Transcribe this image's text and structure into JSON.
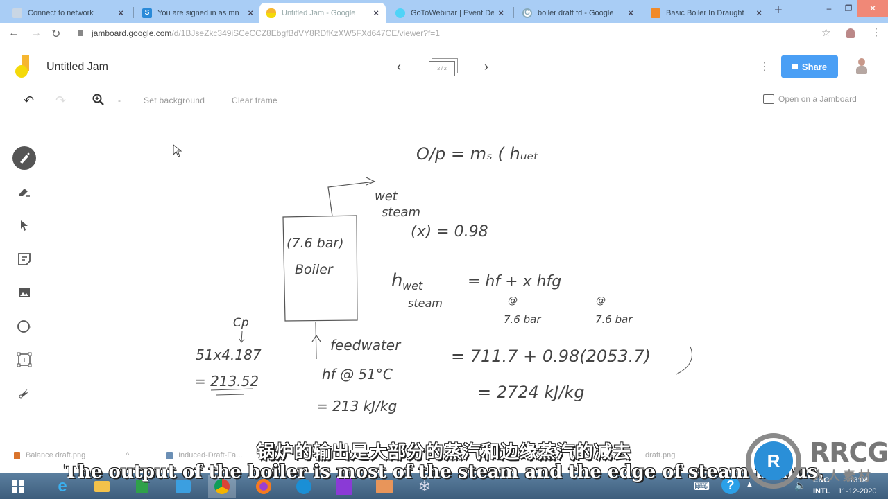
{
  "browser": {
    "tabs": [
      {
        "label": "Connect to network",
        "icon": "network-icon",
        "active": false
      },
      {
        "label": "You are signed in as mn",
        "icon": "s-app-icon",
        "active": false
      },
      {
        "label": "Untitled Jam - Google",
        "icon": "jamboard-icon",
        "active": true
      },
      {
        "label": "GoToWebinar | Event De",
        "icon": "gotowebinar-icon",
        "active": false
      },
      {
        "label": "boiler draft fd - Google",
        "icon": "google-icon",
        "active": false
      },
      {
        "label": "Basic Boiler In Draught",
        "icon": "slides-icon",
        "active": false
      }
    ],
    "new_tab": "+",
    "window_controls": {
      "minimize": "–",
      "restore": "❐",
      "close": "✕"
    },
    "close_glyph": "×",
    "url_host": "jamboard.google.com",
    "url_path": "/d/1BJseZkc349iSCeCCZ8EbgfBdVY8RDfKzXW5FXd647CE/viewer?f=1"
  },
  "jam": {
    "title": "Untitled Jam",
    "frame_indicator": "2 / 2",
    "prev": "‹",
    "next": "›",
    "share_label": "Share",
    "open_on_jamboard": "Open on a Jamboard",
    "toolbar": {
      "set_background": "Set background",
      "clear_frame": "Clear frame",
      "zoom_minus": "-"
    },
    "tools": [
      {
        "name": "pen",
        "active": true
      },
      {
        "name": "eraser",
        "active": false
      },
      {
        "name": "select",
        "active": false
      },
      {
        "name": "sticky-note",
        "active": false
      },
      {
        "name": "image",
        "active": false
      },
      {
        "name": "circle",
        "active": false
      },
      {
        "name": "text-box",
        "active": false
      },
      {
        "name": "laser",
        "active": false
      }
    ]
  },
  "canvas": {
    "output_eq": "O/p = mₛ ( hᵤₑₜ",
    "wet": "wet",
    "steam": "steam",
    "dryness": "(x) = 0.98",
    "boiler_pressure": "(7.6 bar)",
    "boiler_label": "Boiler",
    "h_wet": "h",
    "h_wet_sub": "wet",
    "h_steam": "steam",
    "h_eq": "= hf  +  x hfg",
    "at1": "@",
    "at2": "@",
    "p1": "7.6 bar",
    "p2": "7.6 bar",
    "cp": "Cp",
    "cp_calc": "51x4.187",
    "cp_result": "= 213.52",
    "feedwater": "feedwater",
    "hf_at": "hf @ 51°C",
    "hf_val": "= 213 kJ/kg",
    "calc1": "= 711.7 + 0.98(2053.7)",
    "calc2": "= 2724 kJ/kg"
  },
  "downloads": [
    {
      "label": "Balance draft.png"
    },
    {
      "label": "Induced-Draft-Fa..."
    },
    {
      "label": "draft.png"
    }
  ],
  "subtitles": {
    "chinese": "锅炉的输出是大部分的蒸汽和边缘蒸汽的减去",
    "english": "The output of the boiler is most of the steam and the edge of steam minus."
  },
  "taskbar": {
    "lang_top": "ENG",
    "lang_bottom": "INTL",
    "time": "13:04",
    "date": "11-12-2020"
  },
  "watermark": {
    "brand": "RRCG",
    "sub": "人人素材"
  }
}
